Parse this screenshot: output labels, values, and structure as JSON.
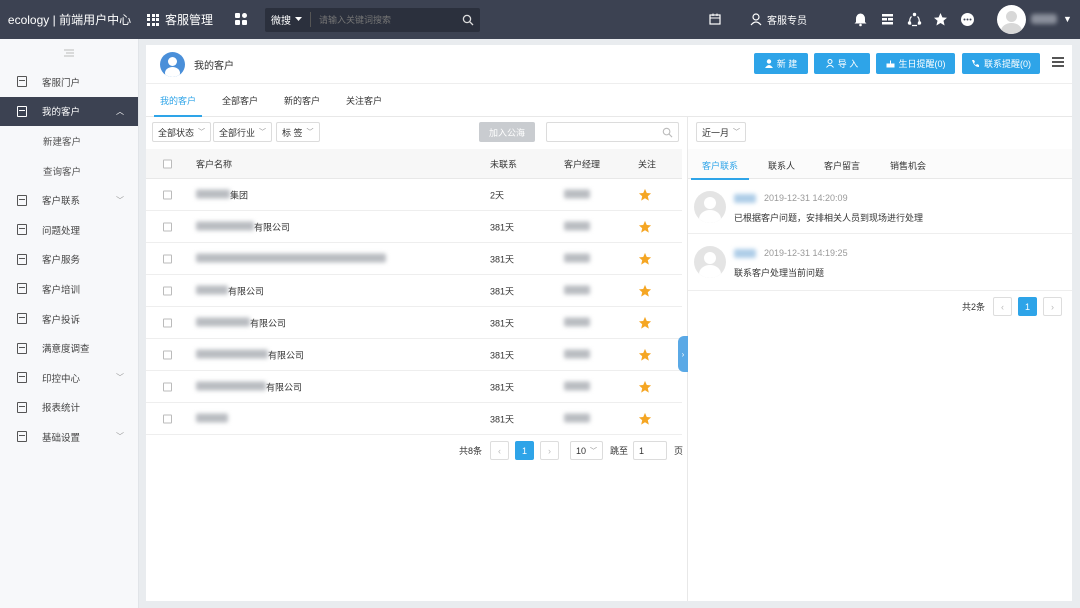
{
  "brand": "ecology | 前端用户中心",
  "app_name": "客服管理",
  "search": {
    "scope": "微搜",
    "placeholder": "请输入关键词搜索"
  },
  "topbar": {
    "user_special": "客服专员"
  },
  "sidebar": {
    "items": [
      {
        "label": "客服门户",
        "expandable": false
      },
      {
        "label": "我的客户",
        "expandable": true,
        "active": true,
        "children": [
          "新建客户",
          "查询客户"
        ]
      },
      {
        "label": "客户联系",
        "expandable": true
      },
      {
        "label": "问题处理",
        "expandable": false
      },
      {
        "label": "客户服务",
        "expandable": false
      },
      {
        "label": "客户培训",
        "expandable": false
      },
      {
        "label": "客户投诉",
        "expandable": false
      },
      {
        "label": "满意度调查",
        "expandable": false
      },
      {
        "label": "印控中心",
        "expandable": true
      },
      {
        "label": "报表统计",
        "expandable": false
      },
      {
        "label": "基础设置",
        "expandable": true
      }
    ]
  },
  "page": {
    "title": "我的客户",
    "buttons": {
      "new": "新 建",
      "import": "导 入",
      "birthday": "生日提醒(0)",
      "contact_remind": "联系提醒(0)"
    },
    "tabs": [
      "我的客户",
      "全部客户",
      "新的客户",
      "关注客户"
    ]
  },
  "filters": {
    "status": "全部状态",
    "industry": "全部行业",
    "tag": "标 签",
    "add_to_pool": "加入公海",
    "period": "近一月"
  },
  "table": {
    "headers": {
      "name": "客户名称",
      "last_contact": "未联系",
      "manager": "客户经理",
      "follow": "关注"
    },
    "rows": [
      {
        "name_suffix": "集团",
        "last_contact": "2天"
      },
      {
        "name_suffix": "有限公司",
        "last_contact": "381天"
      },
      {
        "name_suffix": "",
        "last_contact": "381天"
      },
      {
        "name_suffix": "有限公司",
        "last_contact": "381天"
      },
      {
        "name_suffix": "有限公司",
        "last_contact": "381天"
      },
      {
        "name_suffix": "有限公司",
        "last_contact": "381天"
      },
      {
        "name_suffix": "有限公司",
        "last_contact": "381天"
      },
      {
        "name_suffix": "",
        "last_contact": "381天"
      }
    ]
  },
  "pager": {
    "total": "共8条",
    "current_page": "1",
    "page_size": "10",
    "goto_label": "跳至",
    "goto_value": "1",
    "page_unit": "页"
  },
  "right": {
    "tabs": [
      "客户联系",
      "联系人",
      "客户留言",
      "销售机会"
    ],
    "contacts": [
      {
        "time": "2019-12-31 14:20:09",
        "text": "已根据客户问题，安排相关人员到现场进行处理"
      },
      {
        "time": "2019-12-31 14:19:25",
        "text": "联系客户处理当前问题"
      }
    ],
    "pager": {
      "total": "共2条",
      "current_page": "1"
    }
  },
  "colors": {
    "accent": "#2ea4e8",
    "topbar": "#3c4252",
    "star": "#f5a623"
  }
}
